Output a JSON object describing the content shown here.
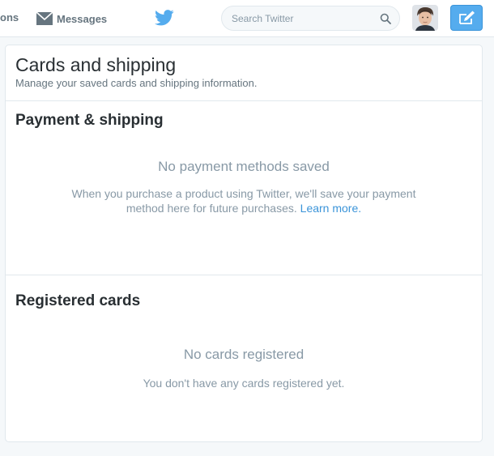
{
  "topbar": {
    "nav_partial_label": "ons",
    "messages_label": "Messages",
    "search_placeholder": "Search Twitter"
  },
  "card": {
    "title": "Cards and shipping",
    "subtitle": "Manage your saved cards and shipping information.",
    "payment_section": {
      "title": "Payment & shipping",
      "empty_title": "No payment methods saved",
      "empty_line1": "When you purchase a product using Twitter, we'll save your payment",
      "empty_line2": "method here for future purchases.",
      "learn_more": "Learn more."
    },
    "registered_section": {
      "title": "Registered cards",
      "empty_title": "No cards registered",
      "empty_text": "You don't have any cards registered yet."
    }
  },
  "colors": {
    "brand": "#55acee",
    "link": "#3b94d9",
    "muted": "#8899a6"
  }
}
